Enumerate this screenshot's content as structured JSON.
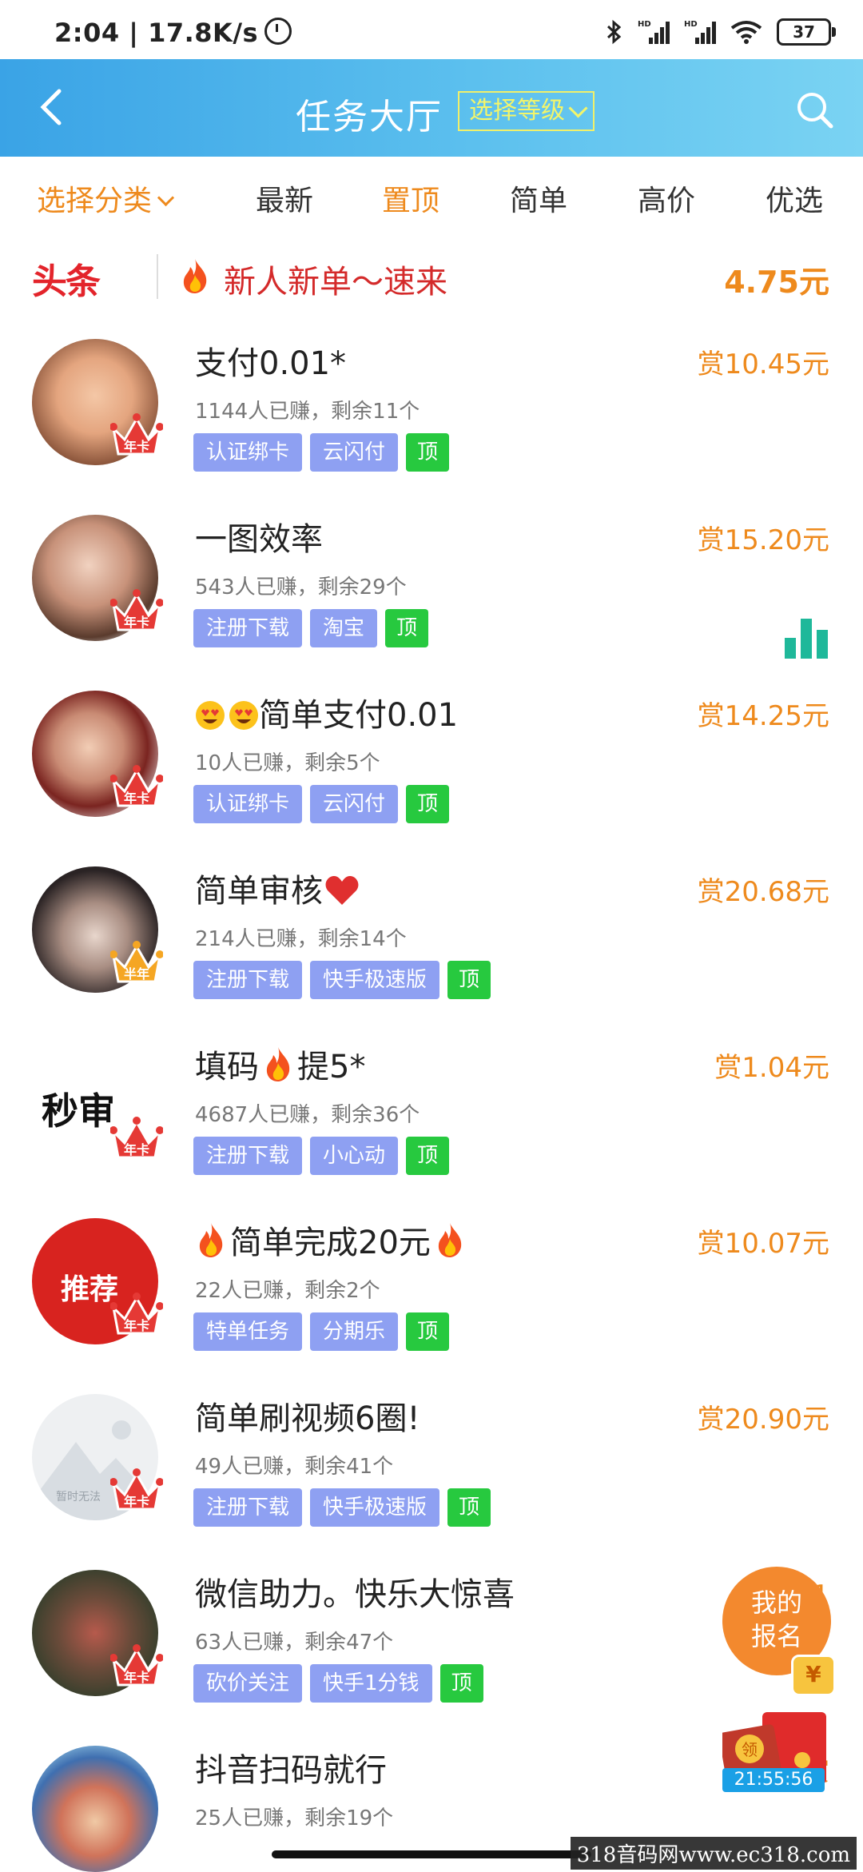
{
  "status_bar": {
    "time_speed": "2:04 | 17.8K/s",
    "signal1": "HD",
    "signal2": "HD",
    "battery": "37"
  },
  "header": {
    "title": "任务大厅",
    "level_select": "选择等级",
    "bg_color": "#4fb6ec"
  },
  "tabs": [
    {
      "label": "选择分类"
    },
    {
      "label": "最新"
    },
    {
      "label": "置顶"
    },
    {
      "label": "简单"
    },
    {
      "label": "高价"
    },
    {
      "label": "优选"
    }
  ],
  "headline": {
    "logo": "头条",
    "text": "新人新单～速来",
    "amount": "4.75元"
  },
  "tasks": [
    {
      "title": "支付0.01*",
      "stats": "1144人已赚，剩余11个",
      "tags": [
        "认证绑卡",
        "云闪付"
      ],
      "top": "顶",
      "reward": "赏10.45元",
      "badge": "年卡"
    },
    {
      "title": "一图效率",
      "stats": "543人已赚，剩余29个",
      "tags": [
        "注册下载",
        "淘宝"
      ],
      "top": "顶",
      "reward": "赏15.20元",
      "badge": "年卡"
    },
    {
      "title": "简单支付0.01",
      "stats": "10人已赚，剩余5个",
      "tags": [
        "认证绑卡",
        "云闪付"
      ],
      "top": "顶",
      "reward": "赏14.25元",
      "badge": "年卡"
    },
    {
      "title": "简单审核",
      "stats": "214人已赚，剩余14个",
      "tags": [
        "注册下载",
        "快手极速版"
      ],
      "top": "顶",
      "reward": "赏20.68元",
      "badge": "半年"
    },
    {
      "title_a": "填码",
      "title_b": "提5*",
      "stats": "4687人已赚，剩余36个",
      "tags": [
        "注册下载",
        "小心动"
      ],
      "top": "顶",
      "reward": "赏1.04元",
      "badge": "年卡",
      "avatar_text": "秒审"
    },
    {
      "title": "简单完成20元",
      "stats": "22人已赚，剩余2个",
      "tags": [
        "特单任务",
        "分期乐"
      ],
      "top": "顶",
      "reward": "赏10.07元",
      "badge": "年卡",
      "avatar_text": "推荐"
    },
    {
      "title": "简单刷视频6圈!",
      "stats": "49人已赚，剩余41个",
      "tags": [
        "注册下载",
        "快手极速版"
      ],
      "top": "顶",
      "reward": "赏20.90元",
      "badge": "年卡",
      "avatar_text": "暂时无法"
    },
    {
      "title": "微信助力。快乐大惊喜",
      "stats": "63人已赚，剩余47个",
      "tags": [
        "砍价关注",
        "快手1分钱"
      ],
      "top": "顶",
      "reward": "赏1",
      "badge": "年卡"
    },
    {
      "title": "抖音扫码就行",
      "stats": "25人已赚，剩余19个",
      "reward": "赏"
    }
  ],
  "float": {
    "my_signup": "我的报名",
    "yen": "¥",
    "receive": "领",
    "timer": "21:55:56"
  },
  "watermark": "318音码网www.ec318.com"
}
